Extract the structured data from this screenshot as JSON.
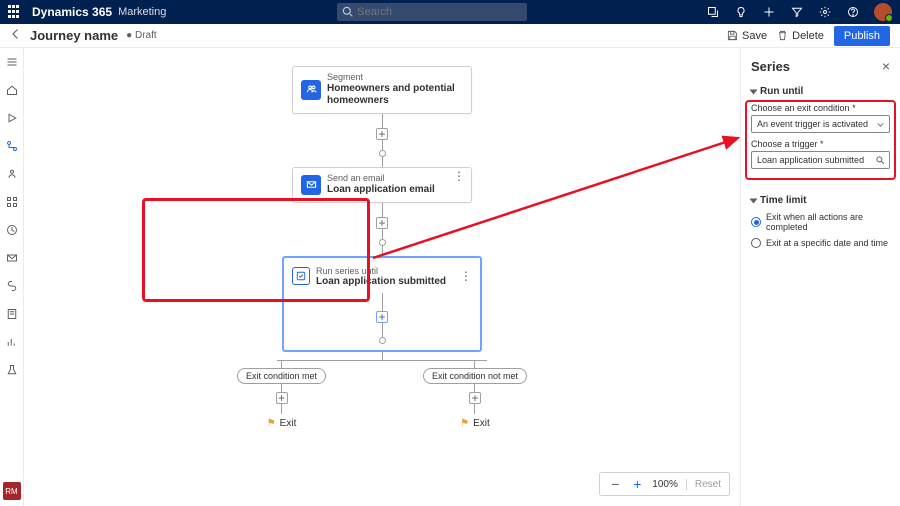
{
  "topbar": {
    "brand": "Dynamics 365",
    "area": "Marketing",
    "search_placeholder": "Search"
  },
  "cmdbar": {
    "title": "Journey name",
    "status": "● Draft",
    "save": "Save",
    "delete": "Delete",
    "publish": "Publish"
  },
  "leftnav_badge": "RM",
  "flow": {
    "segment": {
      "label": "Segment",
      "value": "Homeowners and potential homeowners"
    },
    "email": {
      "label": "Send an email",
      "value": "Loan application email"
    },
    "series": {
      "label": "Run series until",
      "value": "Loan application submitted"
    },
    "branch_met": "Exit condition met",
    "branch_notmet": "Exit condition not met",
    "exit": "Exit"
  },
  "zoom": {
    "level": "100%",
    "reset": "Reset"
  },
  "panel": {
    "title": "Series",
    "run_until": "Run until",
    "exit_cond_label": "Choose an exit condition *",
    "exit_cond_value": "An event trigger is activated",
    "trigger_label": "Choose a trigger *",
    "trigger_value": "Loan application submitted",
    "time_limit": "Time limit",
    "radio1": "Exit when all actions are completed",
    "radio2": "Exit at a specific date and time"
  }
}
